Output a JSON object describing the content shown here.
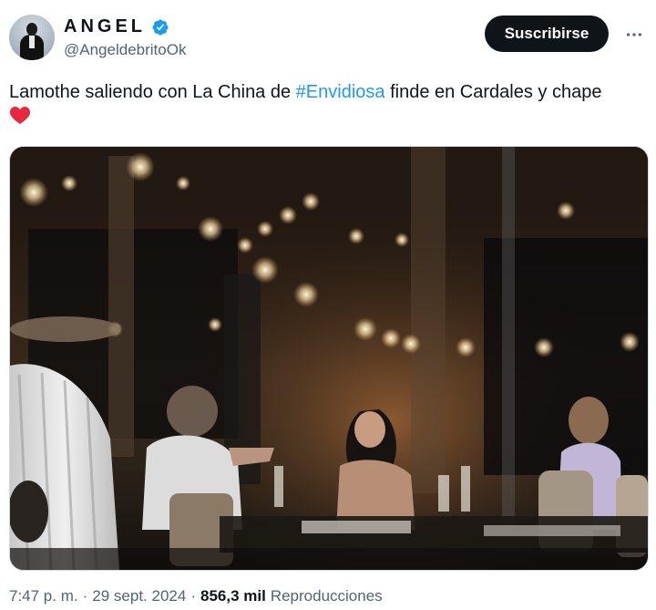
{
  "author": {
    "display_name": "ANGEL",
    "handle": "@AngeldebritoOk",
    "verified": true,
    "avatar_icon": "profile-photo"
  },
  "actions": {
    "subscribe_label": "Suscribirse",
    "more_icon": "more-horizontal-icon"
  },
  "tweet": {
    "text_before": "Lamothe saliendo con La China de ",
    "hashtag": "#Envidiosa",
    "text_after": " finde en Cardales y chape",
    "emoji": "red-heart"
  },
  "footer": {
    "time": "7:47 p. m.",
    "separator": "·",
    "date": "29 sept. 2024",
    "views_count": "856,3 mil",
    "views_label": "Reproducciones"
  },
  "colors": {
    "text": "#0f1419",
    "secondary": "#536471",
    "link": "#1d9bf0",
    "button_bg": "#0f1419",
    "verified": "#1d9bf0",
    "heart": "#f91880"
  }
}
